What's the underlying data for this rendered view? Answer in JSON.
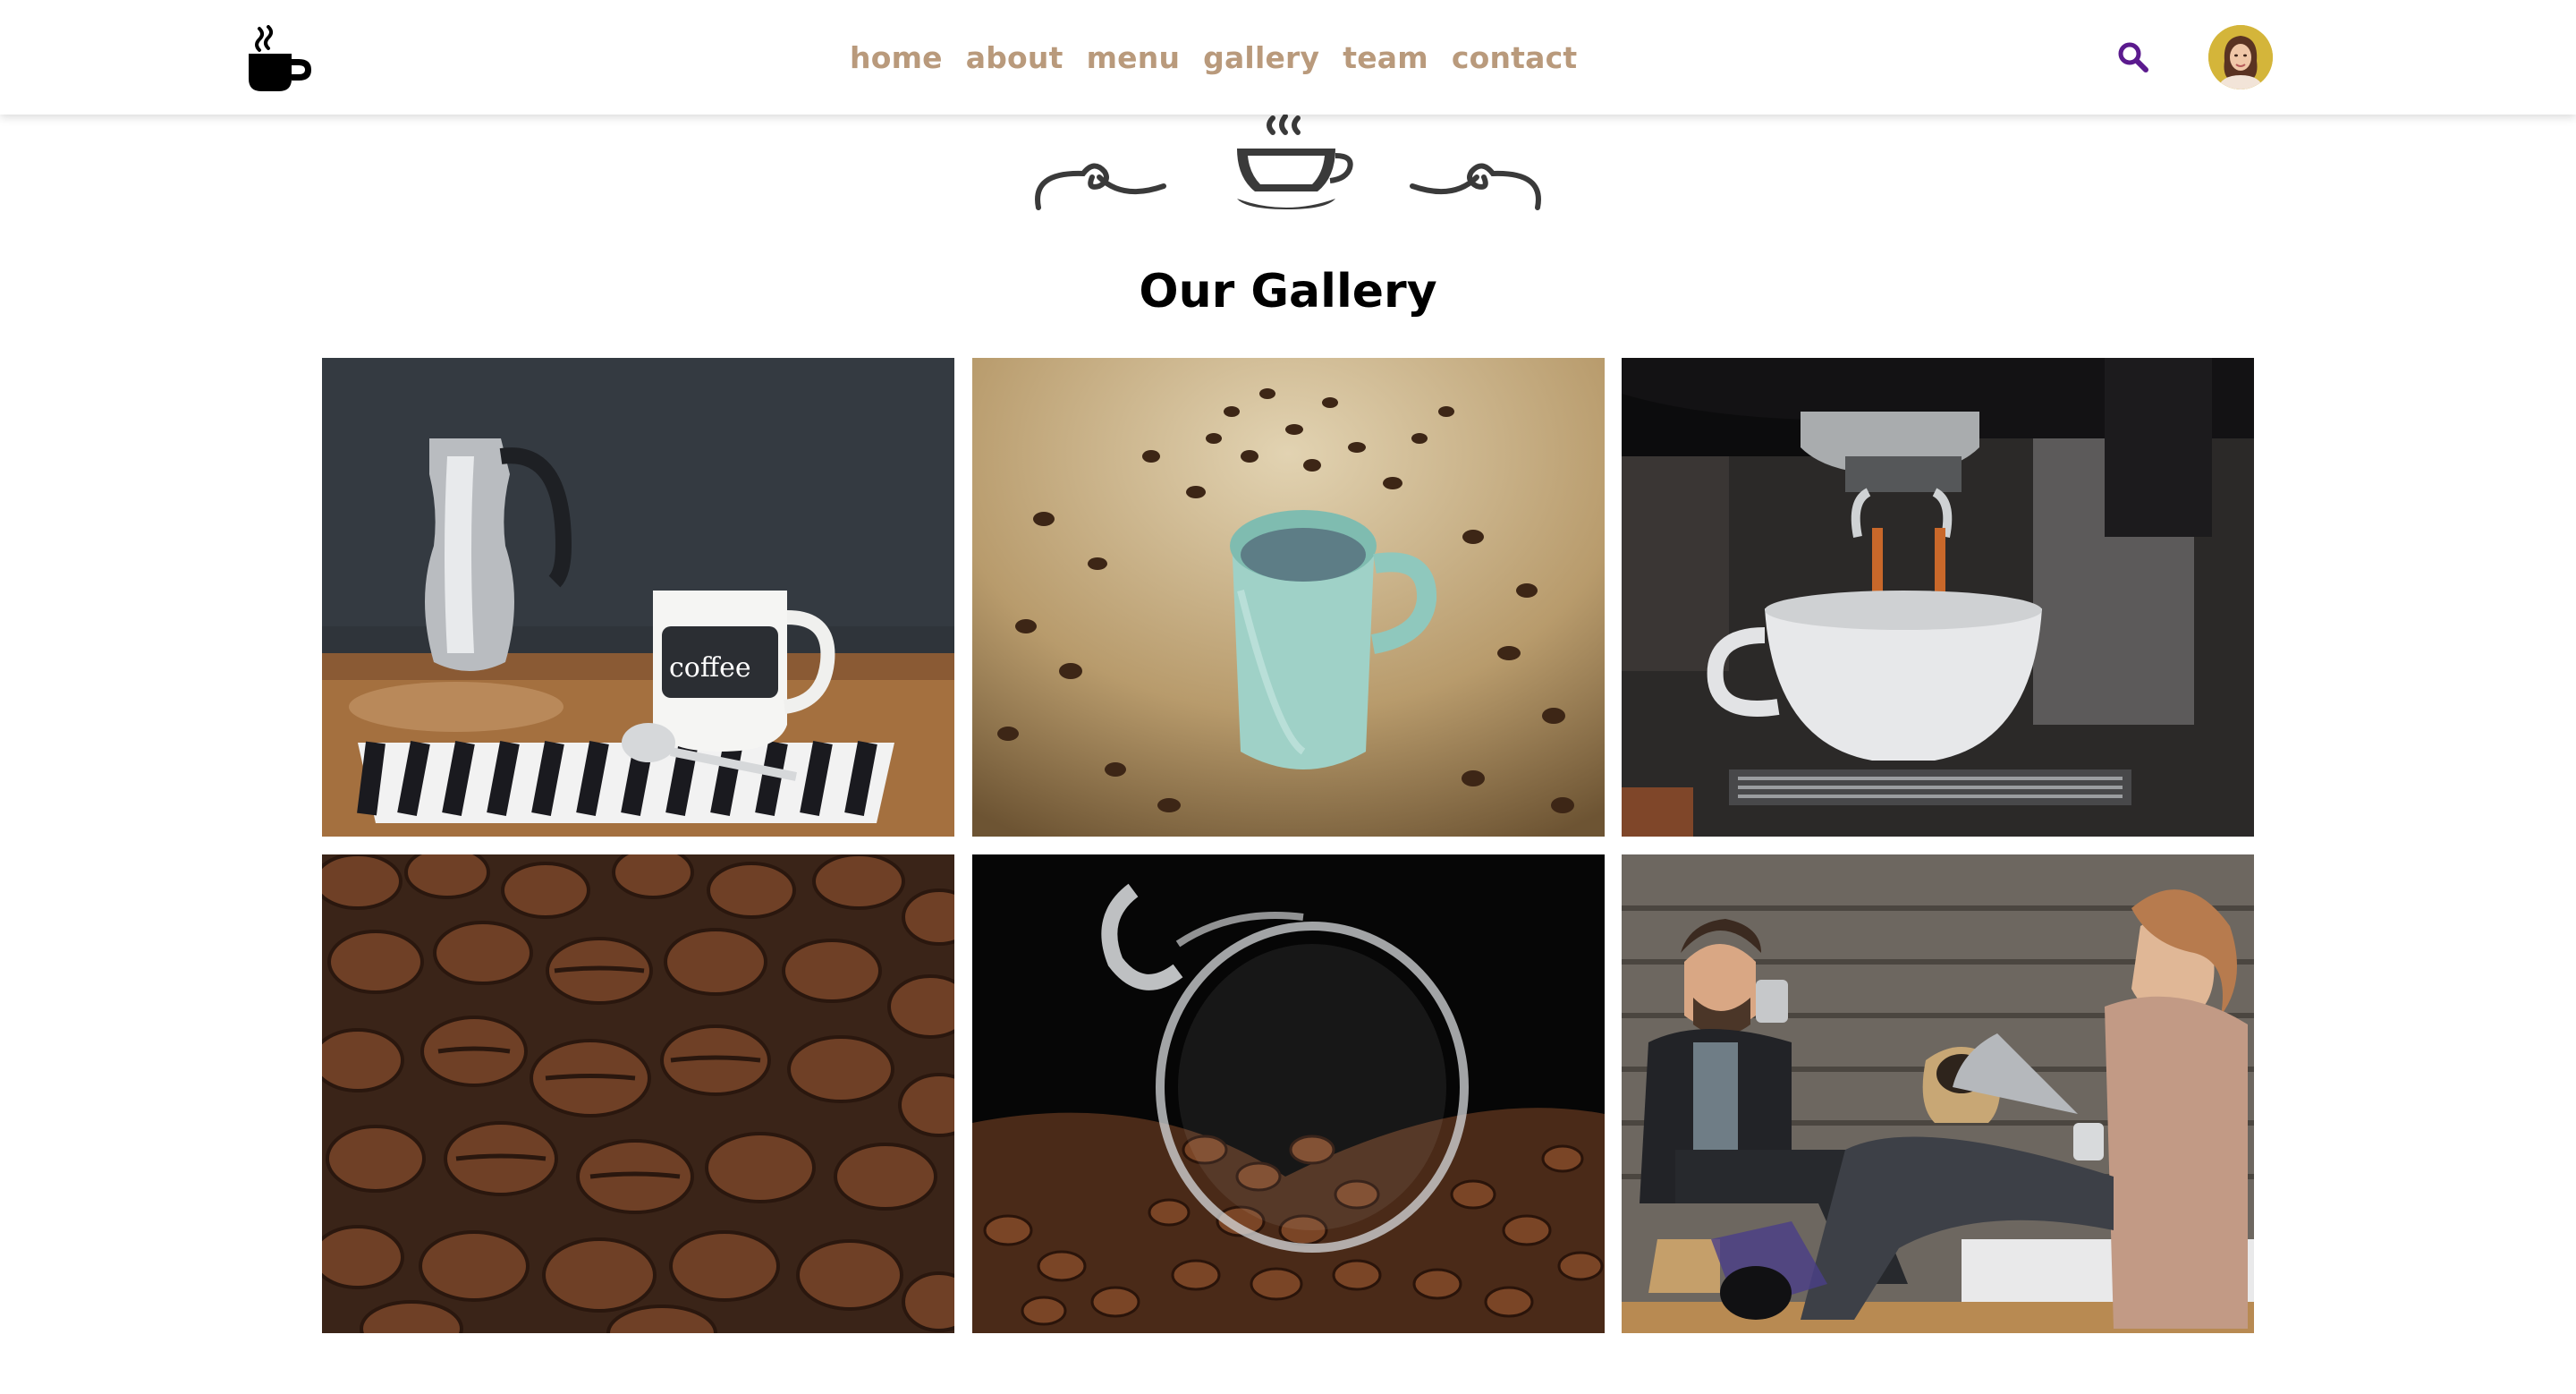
{
  "nav": {
    "items": [
      {
        "label": "home"
      },
      {
        "label": "about"
      },
      {
        "label": "menu"
      },
      {
        "label": "gallery"
      },
      {
        "label": "team"
      },
      {
        "label": "contact"
      }
    ]
  },
  "icons": {
    "logo": "coffee-mug-icon",
    "search": "search-icon",
    "ornament": "coffee-cup-ornament-icon"
  },
  "colors": {
    "nav_text": "#b99a7c",
    "search_icon": "#5b1a8e",
    "title_text": "#000000"
  },
  "gallery": {
    "title": "Our Gallery",
    "photos": [
      {
        "subject": "coffee pot and mug on striped towel",
        "mug_text": "coffee"
      },
      {
        "subject": "green coffee cup on burlap with coffee beans"
      },
      {
        "subject": "espresso machine pouring into white cup"
      },
      {
        "subject": "close-up of roasted coffee beans"
      },
      {
        "subject": "glass cup tipped over spilling coffee beans"
      },
      {
        "subject": "couple with pug drinking coffee"
      }
    ]
  }
}
